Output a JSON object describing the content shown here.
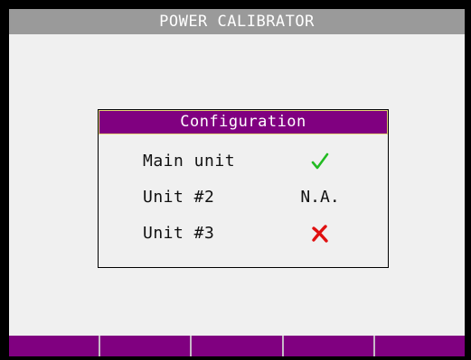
{
  "app": {
    "title": "POWER CALIBRATOR"
  },
  "dialog": {
    "title": "Configuration",
    "rows": [
      {
        "label": "Main unit",
        "status_text": "",
        "status_icon": "green-checkmark-icon"
      },
      {
        "label": "Unit #2",
        "status_text": "N.A.",
        "status_icon": ""
      },
      {
        "label": "Unit #3",
        "status_text": "",
        "status_icon": "red-x-icon"
      }
    ]
  },
  "softkeys": [
    {
      "label": ""
    },
    {
      "label": ""
    },
    {
      "label": ""
    },
    {
      "label": ""
    },
    {
      "label": ""
    }
  ],
  "colors": {
    "title_bar": "#9a9a9a",
    "accent_purple": "#800080",
    "lcd_background": "#f0f0f0",
    "check_green": "#22bb22",
    "cross_red": "#e01010",
    "dialog_header_border": "#e8d87a"
  }
}
